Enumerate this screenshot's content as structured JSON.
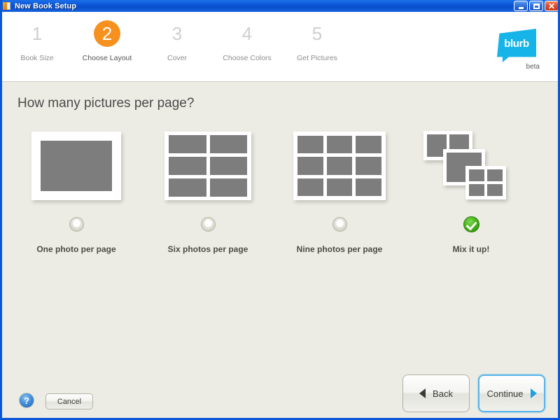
{
  "window": {
    "title": "New Book Setup",
    "title_icon": "book-icon",
    "controls": {
      "minimize": "minimize-icon",
      "maximize": "maximize-icon",
      "close": "close-icon"
    }
  },
  "header": {
    "steps": [
      {
        "number": "1",
        "label": "Book Size",
        "active": false
      },
      {
        "number": "2",
        "label": "Choose Layout",
        "active": true
      },
      {
        "number": "3",
        "label": "Cover",
        "active": false
      },
      {
        "number": "4",
        "label": "Choose Colors",
        "active": false
      },
      {
        "number": "5",
        "label": "Get Pictures",
        "active": false
      }
    ],
    "logo": {
      "name": "blurb",
      "tag": "beta",
      "color": "#16b4e8"
    },
    "active_color": "#f6901e"
  },
  "main": {
    "question": "How many pictures per page?",
    "options": [
      {
        "label": "One photo per page",
        "selected": false,
        "layout": "one"
      },
      {
        "label": "Six photos per page",
        "selected": false,
        "layout": "six"
      },
      {
        "label": "Nine photos per page",
        "selected": false,
        "layout": "nine"
      },
      {
        "label": "Mix it up!",
        "selected": true,
        "layout": "mix"
      }
    ],
    "selected_color": "#46b516"
  },
  "footer": {
    "help_label": "?",
    "cancel_label": "Cancel",
    "back_label": "Back",
    "continue_label": "Continue"
  }
}
